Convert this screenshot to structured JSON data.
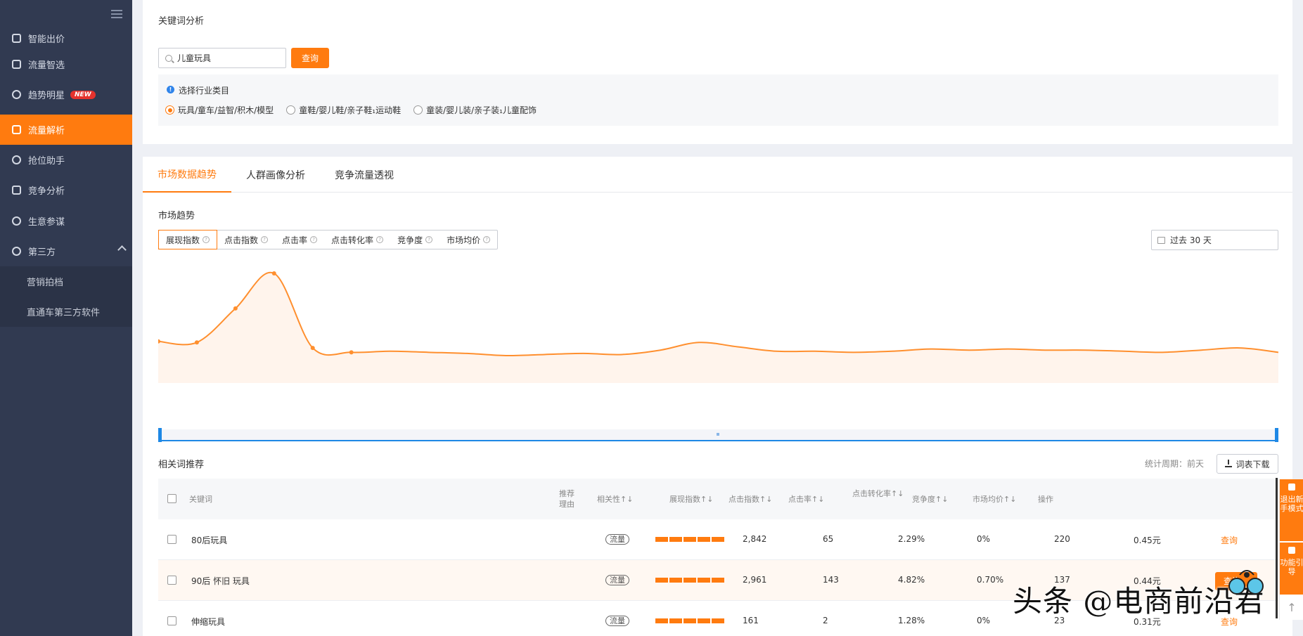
{
  "sidebar": {
    "items": [
      {
        "label": "智能出价",
        "icon": "bid-icon"
      },
      {
        "label": "流量智选",
        "icon": "traffic-select-icon"
      },
      {
        "label": "趋势明星",
        "icon": "trend-icon",
        "badge": "NEW"
      },
      {
        "label": "流量解析",
        "icon": "analysis-icon",
        "active": true
      },
      {
        "label": "抢位助手",
        "icon": "rank-icon"
      },
      {
        "label": "竞争分析",
        "icon": "compete-icon"
      },
      {
        "label": "生意参谋",
        "icon": "business-icon"
      },
      {
        "label": "第三方",
        "icon": "thirdparty-icon",
        "expanded": true
      }
    ],
    "sub_items": [
      {
        "label": "营销拍档"
      },
      {
        "label": "直通车第三方软件"
      }
    ]
  },
  "keyword_panel": {
    "title": "关键词分析",
    "search_value": "儿童玩具",
    "query_button": "查询",
    "category_label": "选择行业类目",
    "categories": [
      {
        "label": "玩具/童车/益智/积木/模型",
        "selected": true
      },
      {
        "label": "童鞋/婴儿鞋/亲子鞋₁运动鞋",
        "selected": false
      },
      {
        "label": "童装/婴儿装/亲子装₁儿童配饰",
        "selected": false
      }
    ]
  },
  "tabs": [
    {
      "label": "市场数据趋势",
      "active": true
    },
    {
      "label": "人群画像分析",
      "active": false
    },
    {
      "label": "竞争流量透视",
      "active": false
    }
  ],
  "market": {
    "title": "市场趋势",
    "metrics": [
      {
        "label": "展现指数",
        "active": true
      },
      {
        "label": "点击指数"
      },
      {
        "label": "点击率"
      },
      {
        "label": "点击转化率"
      },
      {
        "label": "竞争度"
      },
      {
        "label": "市场均价"
      }
    ],
    "date_range": "过去 30 天"
  },
  "chart_data": {
    "type": "area",
    "title": "",
    "xlabel": "",
    "ylabel": "",
    "x": [
      1,
      2,
      3,
      4,
      5,
      6,
      7,
      8,
      9,
      10,
      11,
      12,
      13,
      14,
      15,
      16,
      17,
      18,
      19,
      20,
      21,
      22,
      23,
      24,
      25,
      26,
      27,
      28,
      29,
      30
    ],
    "series": [
      {
        "values": [
          38,
          37,
          68,
          100,
          32,
          28,
          29,
          28,
          27,
          25,
          26,
          27,
          26,
          30,
          37,
          33,
          29,
          29,
          28,
          29,
          31,
          30,
          31,
          30,
          30,
          29,
          28,
          30,
          32,
          28
        ]
      }
    ],
    "marked_points": [
      1,
      2,
      3,
      4,
      5,
      6
    ],
    "colors": {
      "line": "#ff8f2e",
      "fill": "#fff4ec"
    },
    "grid": false
  },
  "related": {
    "title": "相关词推荐",
    "stat_period": "统计周期：前天",
    "download_button": "词表下载",
    "columns": {
      "keyword": "关键词",
      "reason": "推荐理由",
      "relevance": "相关性↑↓",
      "impressions": "展现指数↑↓",
      "clicks": "点击指数↑↓",
      "ctr": "点击率↑↓",
      "cvr": "点击转化率↑↓",
      "competition": "竞争度↑↓",
      "avg_price": "市场均价↑↓",
      "action": "操作"
    },
    "rows": [
      {
        "keyword": "80后玩具",
        "tag": "流量",
        "impressions": "2,842",
        "clicks": "65",
        "ctr": "2.29%",
        "cvr": "0%",
        "competition": "220",
        "avg_price": "0.45元",
        "action": "查询"
      },
      {
        "keyword": "90后 怀旧 玩具",
        "tag": "流量",
        "impressions": "2,961",
        "clicks": "143",
        "ctr": "4.82%",
        "cvr": "0.70%",
        "competition": "137",
        "avg_price": "0.44元",
        "action": "查询"
      },
      {
        "keyword": "伸缩玩具",
        "tag": "流量",
        "impressions": "161",
        "clicks": "2",
        "ctr": "1.28%",
        "cvr": "0%",
        "competition": "23",
        "avg_price": "0.31元",
        "action": "查询"
      }
    ]
  },
  "float_panel": {
    "exit_label": "退出新手模式",
    "guide_label": "功能引导"
  },
  "watermark": "头条 @电商前沿君"
}
